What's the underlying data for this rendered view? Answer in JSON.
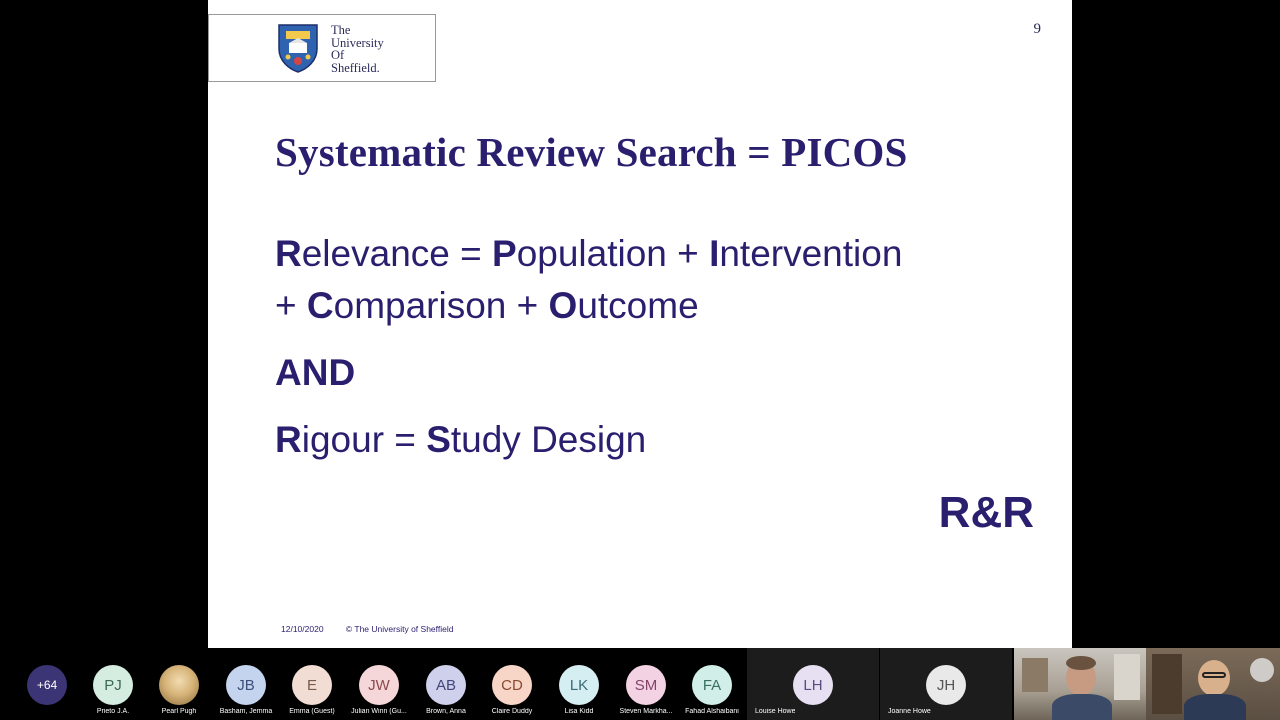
{
  "slide": {
    "logo": {
      "lines": [
        "The",
        "University",
        "Of",
        "Sheffield."
      ]
    },
    "page_number": "9",
    "title": "Systematic Review Search = PICOS",
    "line1": {
      "R": "R",
      "r1": "elevance = ",
      "P": "P",
      "r2": "opulation + ",
      "I": "I",
      "r3": "ntervention"
    },
    "line2": {
      "r0": "+ ",
      "C": "C",
      "r1": "omparison + ",
      "O": "O",
      "r2": "utcome"
    },
    "and": "AND",
    "line4": {
      "R": "R",
      "r1": "igour = ",
      "S": "S",
      "r2": "tudy Design"
    },
    "rr": "R&R",
    "footer": {
      "date": "12/10/2020",
      "copyright": "© The University of Sheffield"
    }
  },
  "participants": [
    {
      "initials": "+64",
      "name": "",
      "color": "#3b3575"
    },
    {
      "initials": "PJ",
      "name": "Prieto J.A.",
      "color": "#d4ede0",
      "text": "#3a6a52"
    },
    {
      "initials": "",
      "name": "Pearl Pugh",
      "color": "#c9a86b",
      "photo": true
    },
    {
      "initials": "JB",
      "name": "Basham, Jemma",
      "color": "#c4d3ee",
      "text": "#3b4f7a"
    },
    {
      "initials": "E",
      "name": "Emma (Guest)",
      "color": "#f1ddd3",
      "text": "#7a5a4c"
    },
    {
      "initials": "JW",
      "name": "Julian Winn (Gu...",
      "color": "#f6d7d9",
      "text": "#8a4a50"
    },
    {
      "initials": "AB",
      "name": "Brown, Anna",
      "color": "#cfd0ec",
      "text": "#44467a"
    },
    {
      "initials": "CD",
      "name": "Claire Duddy",
      "color": "#f7d6c8",
      "text": "#8a4a30"
    },
    {
      "initials": "LK",
      "name": "Lisa Kidd",
      "color": "#d5eef1",
      "text": "#3a6a74"
    },
    {
      "initials": "SM",
      "name": "Steven Markha...",
      "color": "#f3d2e4",
      "text": "#84426a"
    },
    {
      "initials": "FA",
      "name": "Fahad Alshaibani",
      "color": "#d1efe8",
      "text": "#3a6e60"
    },
    {
      "initials": "LH",
      "name": "Louise Howe",
      "color": "#e6e0f2",
      "text": "#5a4e80"
    },
    {
      "initials": "JH",
      "name": "Joanne Howe",
      "color": "#e9e9e9",
      "text": "#555555"
    }
  ]
}
